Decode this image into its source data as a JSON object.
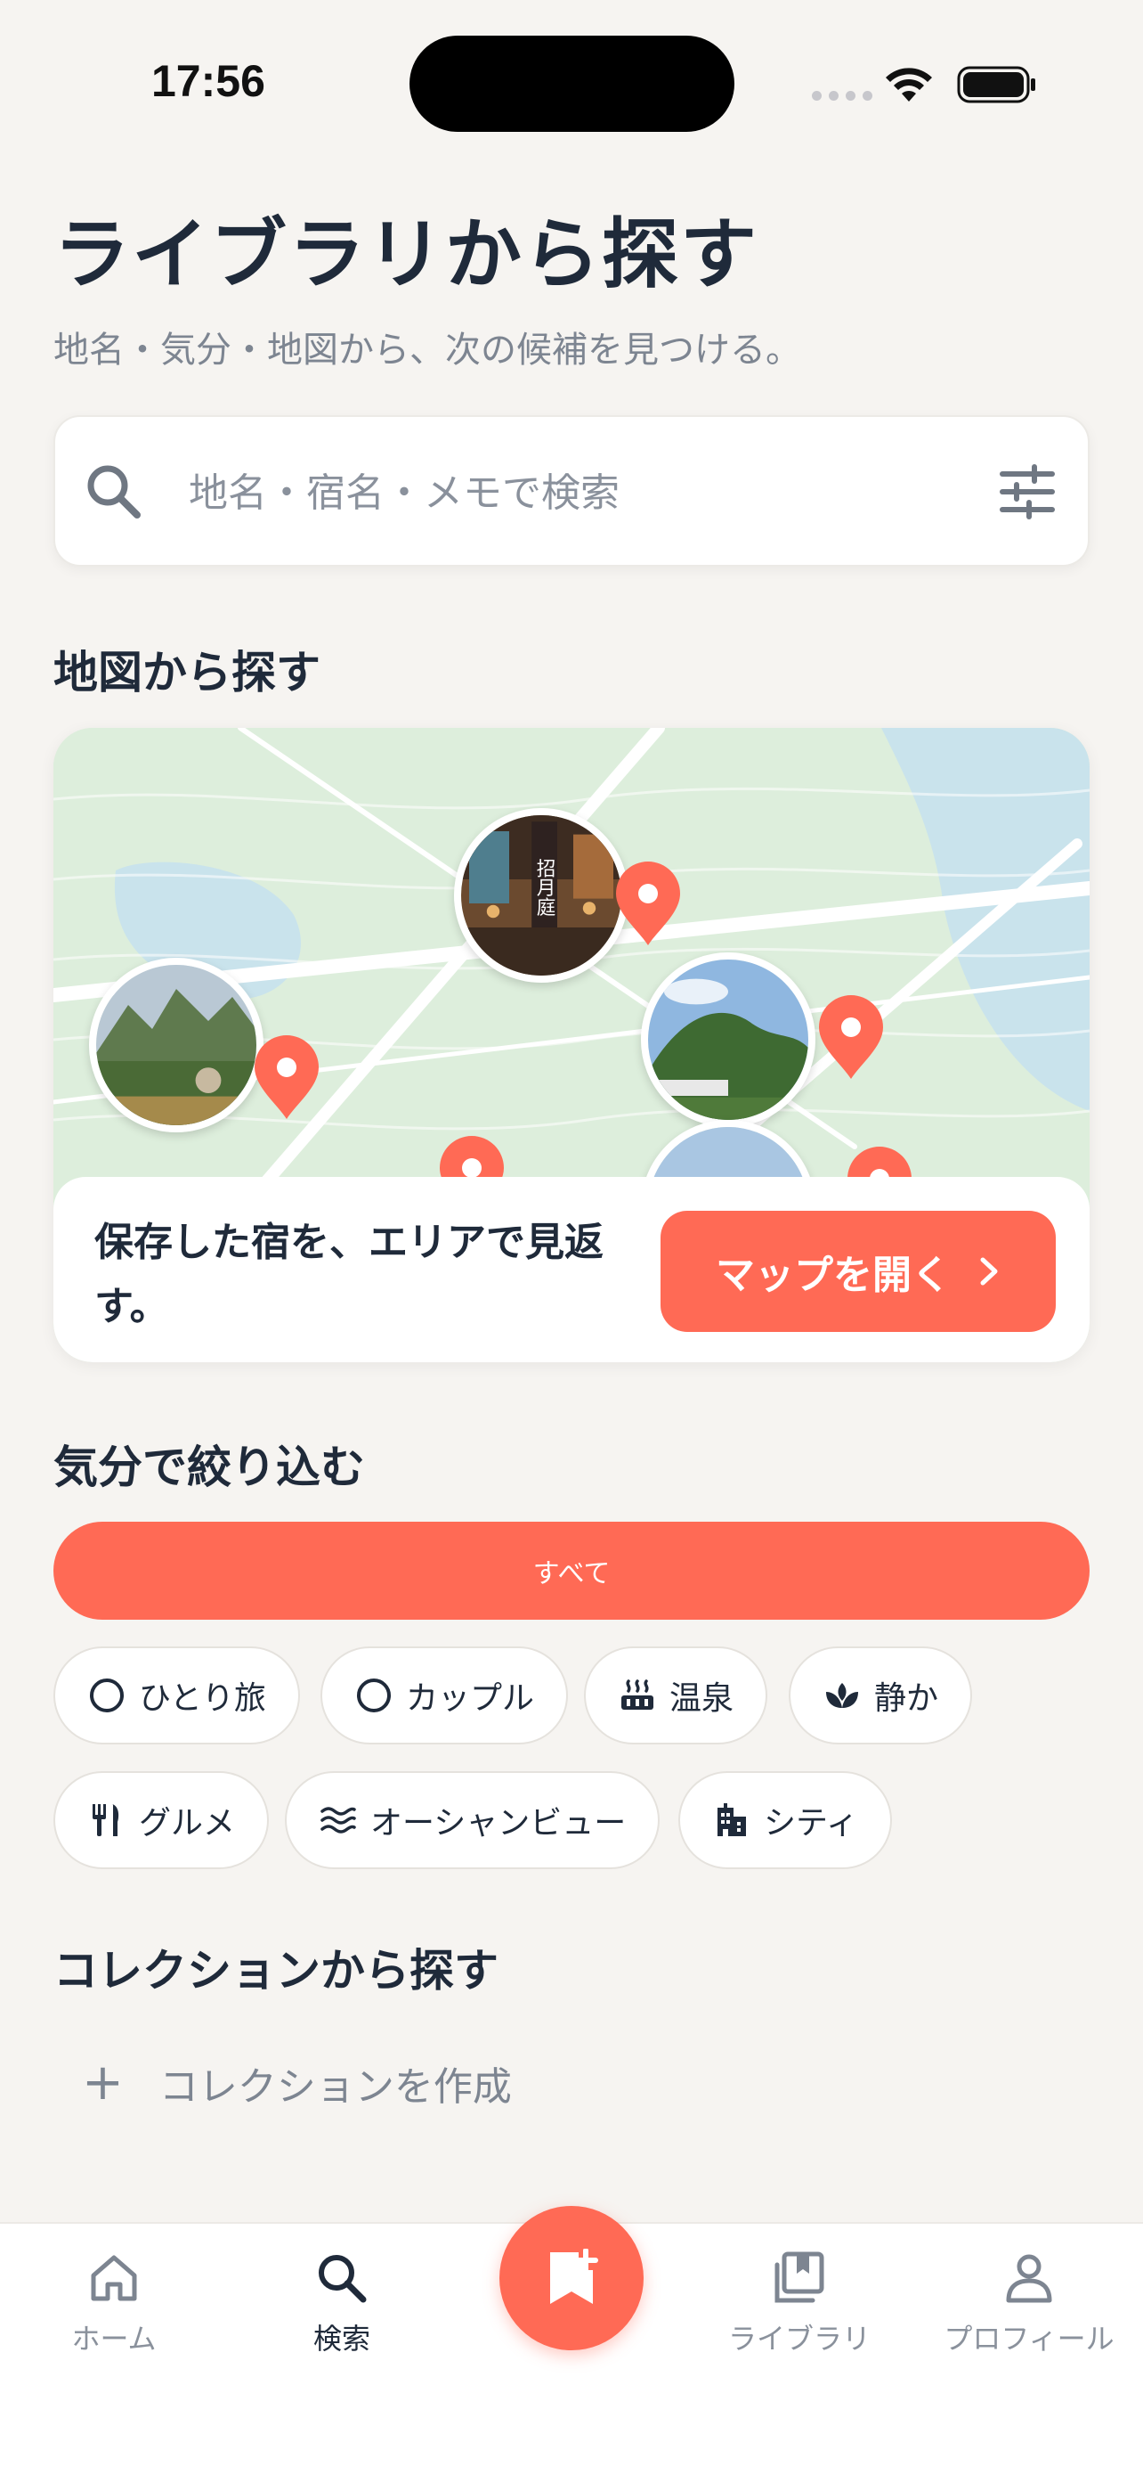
{
  "status_bar": {
    "time": "17:56"
  },
  "header": {
    "title": "ライブラリから探す",
    "subtitle": "地名・気分・地図から、次の候補を見つける。"
  },
  "search": {
    "placeholder": "地名・宿名・メモで検索",
    "value": ""
  },
  "map_section": {
    "heading": "地図から探す",
    "caption": "保存した宿を、エリアで見返す。",
    "open_button": "マップを開く",
    "photo_sign_text": "招月庭"
  },
  "mood_section": {
    "heading": "気分で絞り込む",
    "all_label": "すべて",
    "chips": [
      {
        "label": "ひとり旅",
        "icon": "circle-icon"
      },
      {
        "label": "カップル",
        "icon": "circle-icon"
      },
      {
        "label": "温泉",
        "icon": "hot-spring-icon"
      },
      {
        "label": "静か",
        "icon": "lotus-icon"
      },
      {
        "label": "グルメ",
        "icon": "fork-knife-icon"
      },
      {
        "label": "オーシャンビュー",
        "icon": "waves-icon"
      },
      {
        "label": "シティ",
        "icon": "building-icon"
      }
    ]
  },
  "collection_section": {
    "heading": "コレクションから探す",
    "create_label": "コレクションを作成"
  },
  "tabbar": {
    "home": "ホーム",
    "search": "検索",
    "library": "ライブラリ",
    "profile": "プロフィール"
  },
  "colors": {
    "accent": "#FF6A55",
    "text": "#1F2A3A",
    "muted": "#7D8591",
    "background": "#F6F4F1"
  }
}
